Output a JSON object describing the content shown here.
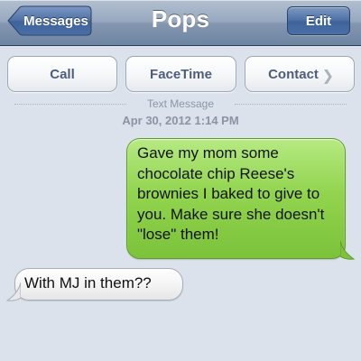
{
  "navbar": {
    "title": "Pops",
    "back_label": "Messages",
    "edit_label": "Edit"
  },
  "actions": {
    "call": "Call",
    "facetime": "FaceTime",
    "contact": "Contact",
    "contact_chevron": "❯"
  },
  "thread": {
    "message_type": "Text Message",
    "timestamp": "Apr 30, 2012 1:14 PM"
  },
  "messages": [
    {
      "direction": "sent",
      "text": "Gave my mom some chocolate chip Reese's brownies I baked to give to you. Make sure she doesn't \"lose\" them!",
      "color": "#92d44f"
    },
    {
      "direction": "received",
      "text": "With MJ in them??",
      "color": "#f3f3f3"
    }
  ],
  "colors": {
    "navbar": "#8597b0",
    "background": "#dbe2ec",
    "action_text": "#4d5d7e",
    "sent_bubble": "#92d44f",
    "received_bubble": "#f3f3f3"
  }
}
